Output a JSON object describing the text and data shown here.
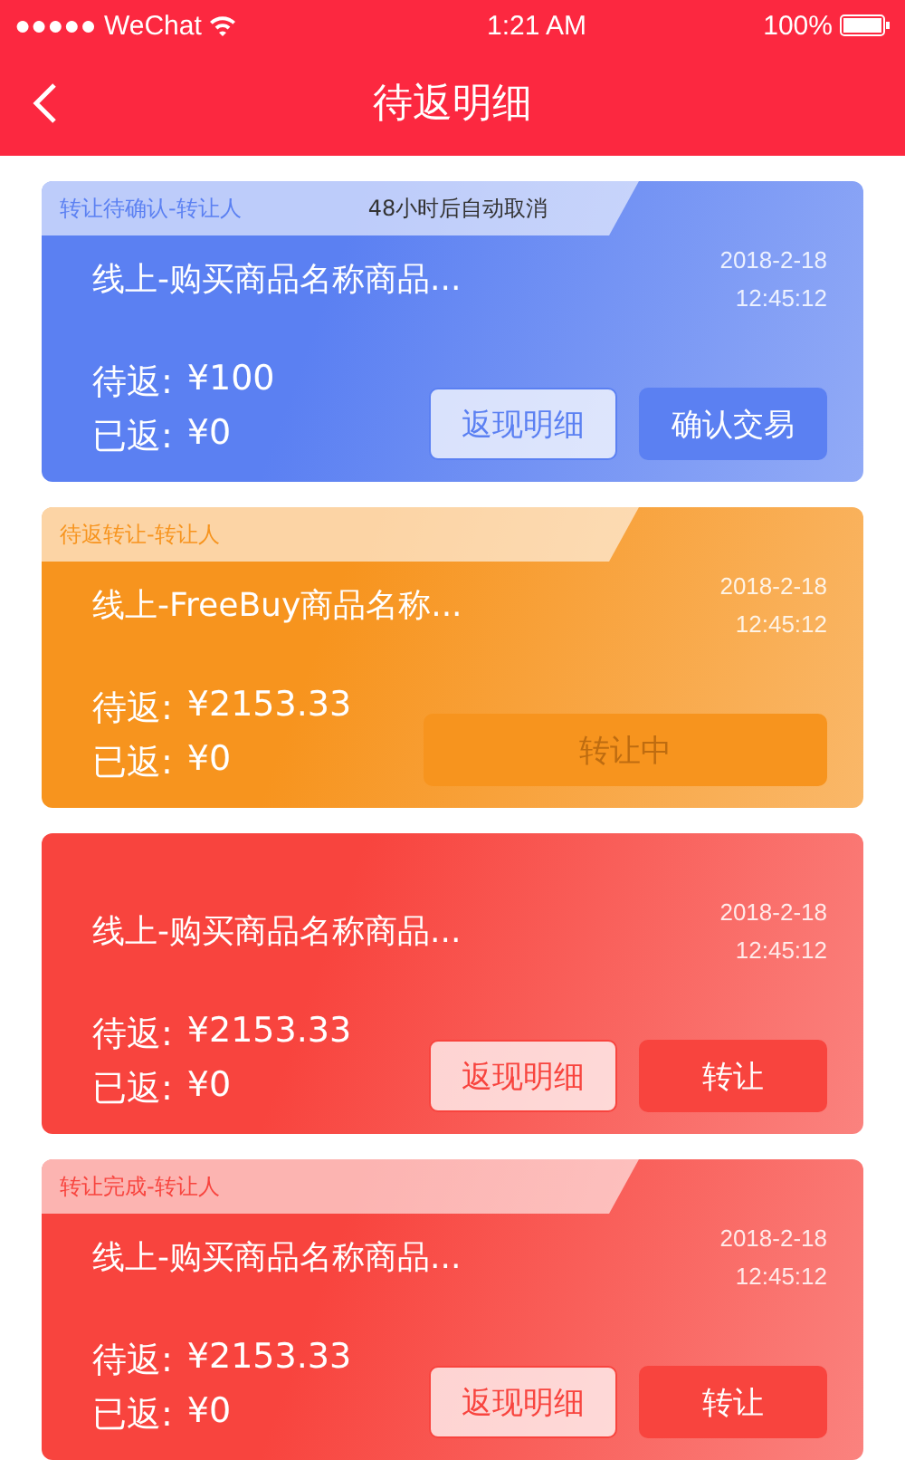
{
  "status_bar": {
    "carrier": "●●●●● WeChat",
    "time": "1:21 AM",
    "battery": "100%"
  },
  "nav": {
    "title": "待返明细"
  },
  "cards": [
    {
      "color": "#5b80f2",
      "tag": {
        "label": "转让待确认-转让人",
        "note": "48小时后自动取消"
      },
      "title": "线上-购买商品名称商品...",
      "date": "2018-2-18",
      "time": "12:45:12",
      "pending": {
        "label": "待返:",
        "amount": "¥100"
      },
      "returned": {
        "label": "已返:",
        "amount": "¥0"
      },
      "buttons": [
        {
          "kind": "outline",
          "label": "返现明细"
        },
        {
          "kind": "solid",
          "label": "确认交易"
        }
      ]
    },
    {
      "color": "#f7941e",
      "tag": {
        "label": "待返转让-转让人"
      },
      "title": "线上-FreeBuy商品名称...",
      "date": "2018-2-18",
      "time": "12:45:12",
      "pending": {
        "label": "待返:",
        "amount": "¥2153.33"
      },
      "returned": {
        "label": "已返:",
        "amount": "¥0"
      },
      "buttons": [
        {
          "kind": "disabled",
          "label": "转让中"
        }
      ]
    },
    {
      "color": "#f8443e",
      "title": "线上-购买商品名称商品...",
      "date": "2018-2-18",
      "time": "12:45:12",
      "pending": {
        "label": "待返:",
        "amount": "¥2153.33"
      },
      "returned": {
        "label": "已返:",
        "amount": "¥0"
      },
      "buttons": [
        {
          "kind": "outline",
          "label": "返现明细"
        },
        {
          "kind": "solid",
          "label": "转让"
        }
      ]
    },
    {
      "color": "#f8443e",
      "tag": {
        "label": "转让完成-转让人"
      },
      "title": "线上-购买商品名称商品...",
      "date": "2018-2-18",
      "time": "12:45:12",
      "pending": {
        "label": "待返:",
        "amount": "¥2153.33"
      },
      "returned": {
        "label": "已返:",
        "amount": "¥0"
      },
      "buttons": [
        {
          "kind": "outline",
          "label": "返现明细"
        },
        {
          "kind": "solid",
          "label": "转让"
        }
      ]
    }
  ]
}
